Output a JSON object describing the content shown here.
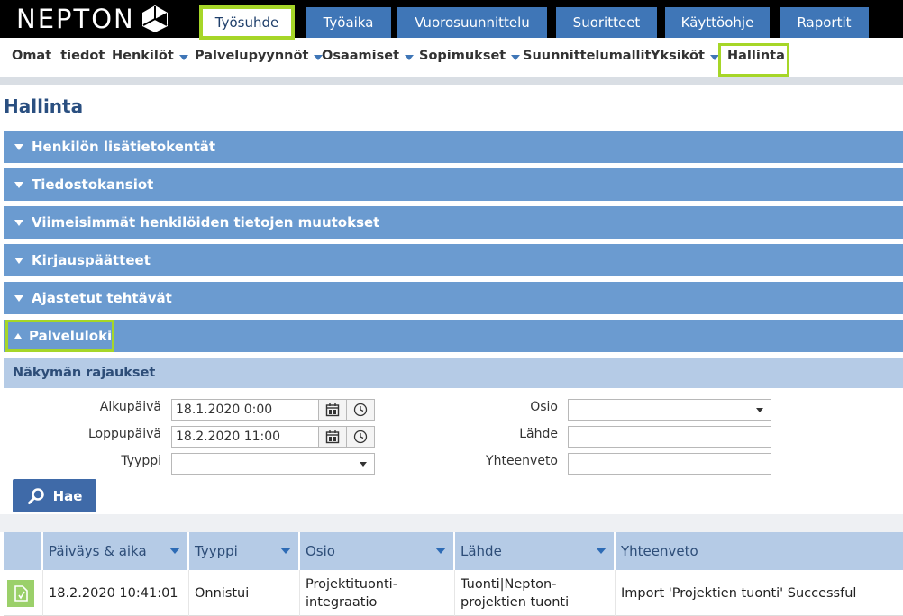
{
  "app": {
    "logo_text": "NEPTON"
  },
  "main_tabs": [
    {
      "label": "Työsuhde",
      "active": true
    },
    {
      "label": "Työaika"
    },
    {
      "label": "Vuorosuunnittelu"
    },
    {
      "label": "Suoritteet"
    },
    {
      "label": "Käyttöohje"
    },
    {
      "label": "Raportit"
    }
  ],
  "subnav": [
    {
      "label": "Omat  tiedot",
      "dropdown": false
    },
    {
      "label": "Henkilöt",
      "dropdown": true
    },
    {
      "label": "Palvelupyynnöt",
      "dropdown": true
    },
    {
      "label": "Osaamiset",
      "dropdown": true
    },
    {
      "label": "Sopimukset",
      "dropdown": true
    },
    {
      "label": "Suunnittelumallit",
      "dropdown": false
    },
    {
      "label": "Yksiköt",
      "dropdown": true
    },
    {
      "label": "Hallinta",
      "dropdown": false,
      "active": true
    }
  ],
  "page_title": "Hallinta",
  "sections": [
    {
      "label": "Henkilön lisätietokentät",
      "expanded": false
    },
    {
      "label": "Tiedostokansiot",
      "expanded": false
    },
    {
      "label": "Viimeisimmät henkilöiden tietojen muutokset",
      "expanded": false
    },
    {
      "label": "Kirjauspäätteet",
      "expanded": false
    },
    {
      "label": "Ajastetut tehtävät",
      "expanded": false
    },
    {
      "label": "Palveluloki",
      "expanded": true
    }
  ],
  "filters": {
    "title": "Näkymän rajaukset",
    "start_label": "Alkupäivä",
    "start_value": "18.1.2020 0:00",
    "end_label": "Loppupäivä",
    "end_value": "18.2.2020 11:00",
    "type_label": "Tyyppi",
    "type_value": "",
    "section_label": "Osio",
    "section_value": "",
    "source_label": "Lähde",
    "source_value": "",
    "summary_label": "Yhteenveto",
    "summary_value": "",
    "search_button": "Hae"
  },
  "table": {
    "columns": [
      "Päiväys & aika",
      "Tyyppi",
      "Osio",
      "Lähde",
      "Yhteenveto"
    ],
    "rows": [
      {
        "datetime": "18.2.2020 10:41:01",
        "type": "Onnistui",
        "section": "Projektituonti-integraatio",
        "source": "Tuonti|Nepton-projektien tuonti",
        "summary": "Import 'Projektien tuonti' Successful"
      }
    ]
  },
  "colors": {
    "accent_highlight": "#a6d628",
    "tab_blue": "#3f76b7",
    "section_blue": "#6b9bd0",
    "header_bg": "#000000"
  }
}
